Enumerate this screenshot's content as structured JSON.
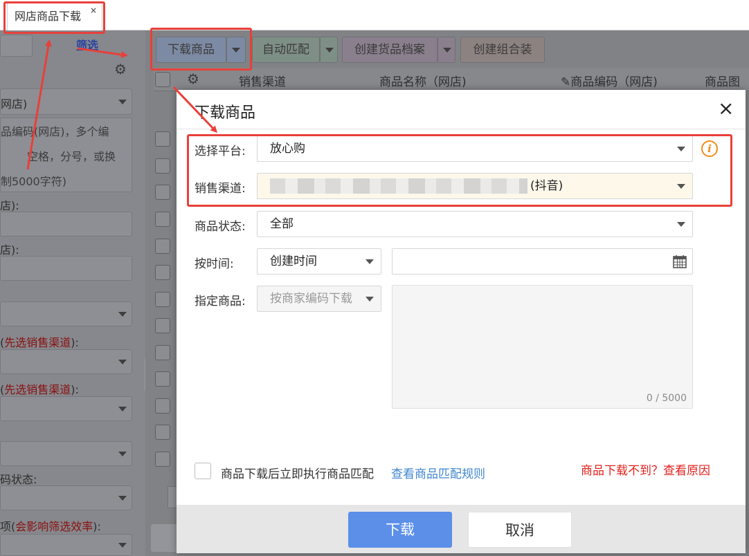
{
  "tab": {
    "label": "网店商品下载",
    "close": "×"
  },
  "left_panel": {
    "filter_link": "筛选",
    "select1_value": "网店)",
    "textarea_lines": [
      "品编码(网店)，多个编",
      "空格，分号，或换",
      "制5000字符)"
    ],
    "label_a": "店):",
    "label_b": "店):",
    "label_c_prefix": "(",
    "label_c_red": "先选销售渠道",
    "label_c_suffix": "):",
    "label_d_prefix": "(",
    "label_d_red": "先选销售渠道",
    "label_d_suffix": "):",
    "label_e": "码状态:",
    "label_f_prefix": "项(",
    "label_f_red": "会影响筛选效率",
    "label_f_suffix": "):"
  },
  "toolbar": {
    "download": "下载商品",
    "auto_match": "自动匹配",
    "create_archive": "创建货品档案",
    "create_combo": "创建组合装"
  },
  "grid": {
    "headers": [
      "销售渠道",
      "商品名称（网店)",
      "✎商品编码（网店)",
      "商品图"
    ]
  },
  "modal": {
    "title": "下载商品",
    "close": "×",
    "fields": {
      "platform_label": "选择平台:",
      "platform_value": "放心购",
      "channel_label": "销售渠道:",
      "channel_suffix": "(抖音)",
      "status_label": "商品状态:",
      "status_value": "全部",
      "time_label": "按时间:",
      "time_value": "创建时间",
      "goods_label": "指定商品:",
      "goods_value": "按商家编码下载",
      "counter": "0 / 5000"
    },
    "checkbox_label": "商品下载后立即执行商品匹配",
    "match_rule_link": "查看商品匹配规则",
    "cannot_download_link": "商品下载不到？查看原因",
    "info_icon": "i",
    "buttons": {
      "ok": "下载",
      "cancel": "取消"
    }
  },
  "colors": {
    "annotation": "#e8403a",
    "primary": "#5b8fe8",
    "link": "#3f86d1",
    "warning": "#f18a1c"
  }
}
